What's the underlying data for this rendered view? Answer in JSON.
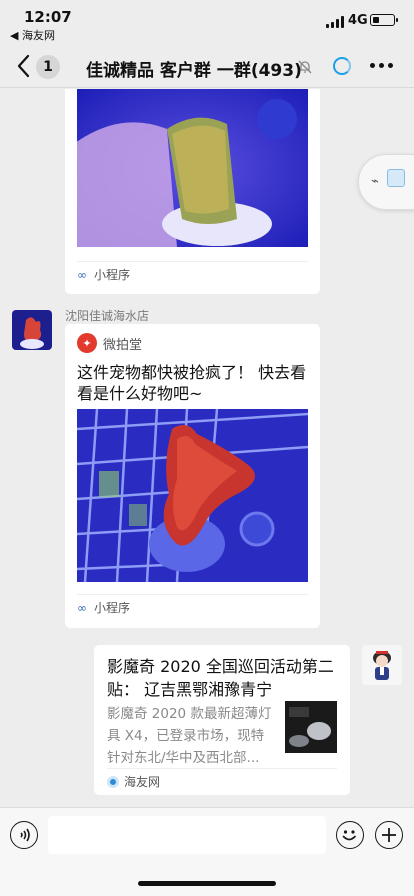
{
  "status": {
    "time": "12:07",
    "back_app": "◀ 海友网",
    "network": "4G",
    "battery_level": 0.35
  },
  "nav": {
    "unread_badge": "1",
    "title": "佳诚精品 客户群 一群(493)"
  },
  "messages": [
    {
      "type": "mini_program",
      "footer": "小程序"
    },
    {
      "type": "mini_program",
      "sender": "沈阳佳诚海水店",
      "brand": "微拍堂",
      "text": "这件宠物都快被抢疯了！ 快去看看是什么好物吧~",
      "footer": "小程序"
    },
    {
      "type": "article",
      "title": "影魔奇 2020 全国巡回活动第二贴：  辽吉黑鄂湘豫青宁",
      "description": "影魔奇 2020 款最新超薄灯具 X4，已登录市场，现特针对东北/华中及西北部...",
      "source": "海友网"
    }
  ],
  "icons": {
    "back": "chevron-left-icon",
    "mute": "mute-bell-icon",
    "circle": "loading-circle-icon",
    "more": "more-dots-icon",
    "voice": "voice-icon",
    "emoji": "emoji-icon",
    "plus": "plus-icon",
    "mini_program": "link-icon"
  },
  "colors": {
    "accent": "#1aa0e6",
    "background": "#ededed",
    "brand_red": "#e23b2e"
  }
}
